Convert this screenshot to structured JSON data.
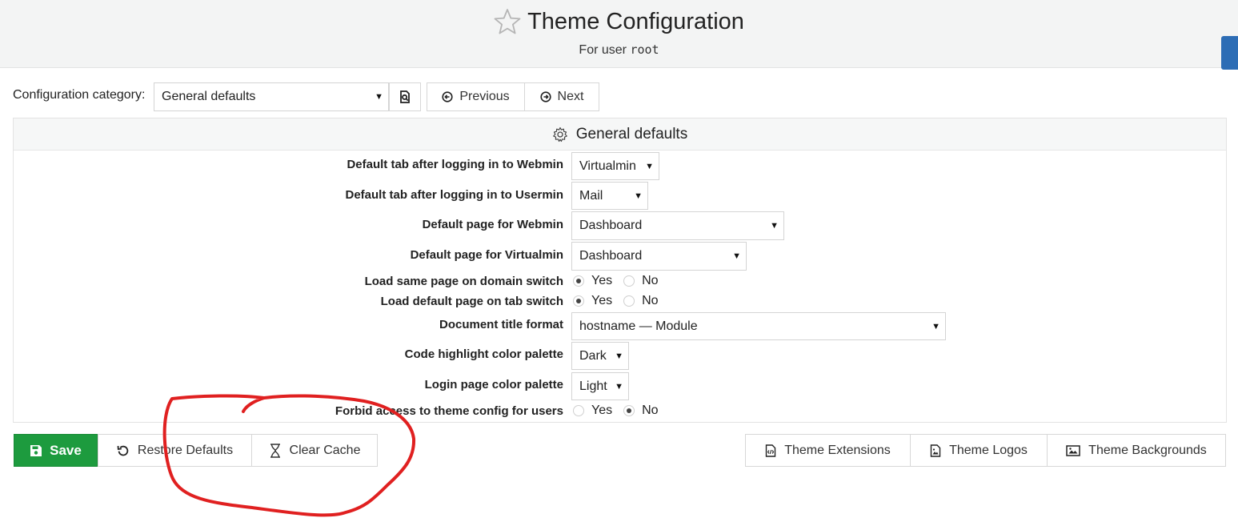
{
  "header": {
    "title": "Theme Configuration",
    "subtitle_prefix": "For user",
    "user": "root"
  },
  "toolbar": {
    "category_label": "Configuration category:",
    "category_value": "General defaults",
    "previous_label": "Previous",
    "next_label": "Next"
  },
  "panel": {
    "title": "General defaults",
    "rows": [
      {
        "label": "Default tab after logging in to Webmin",
        "value": "Virtualmin"
      },
      {
        "label": "Default tab after logging in to Usermin",
        "value": "Mail"
      },
      {
        "label": "Default page for Webmin",
        "value": "Dashboard"
      },
      {
        "label": "Default page for Virtualmin",
        "value": "Dashboard"
      },
      {
        "label": "Load same page on domain switch",
        "yes": "Yes",
        "no": "No",
        "selected": "Yes"
      },
      {
        "label": "Load default page on tab switch",
        "yes": "Yes",
        "no": "No",
        "selected": "Yes"
      },
      {
        "label": "Document title format",
        "value": "hostname — Module"
      },
      {
        "label": "Code highlight color palette",
        "value": "Dark"
      },
      {
        "label": "Login page color palette",
        "value": "Light"
      },
      {
        "label": "Forbid access to theme config for users",
        "yes": "Yes",
        "no": "No",
        "selected": "No"
      }
    ]
  },
  "actions": {
    "save": "Save",
    "restore": "Restore Defaults",
    "clear_cache": "Clear Cache",
    "extensions": "Theme Extensions",
    "logos": "Theme Logos",
    "backgrounds": "Theme Backgrounds"
  },
  "colors": {
    "save_green": "#1d9b3e",
    "annotation_red": "#e02020",
    "side_tab_blue": "#2d6db5"
  },
  "icons": [
    "star-icon",
    "search-icon",
    "previous-icon",
    "next-icon",
    "gear-icon",
    "save-icon",
    "restore-icon",
    "hourglass-icon",
    "extensions-icon",
    "logos-icon",
    "backgrounds-icon"
  ]
}
